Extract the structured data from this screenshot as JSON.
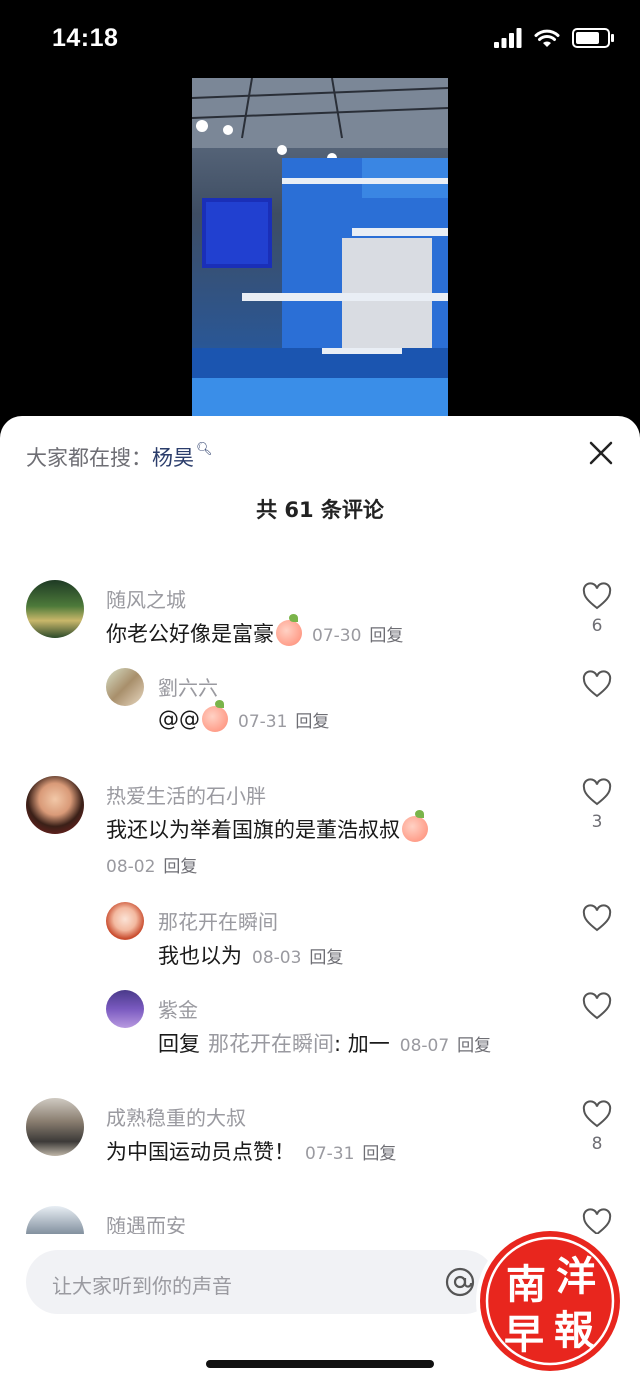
{
  "status_bar": {
    "time": "14:18",
    "battery_level": 0.75
  },
  "sheet": {
    "search_prefix": "大家都在搜：",
    "search_keyword": "杨昊",
    "comment_count": "共 61 条评论"
  },
  "comments": [
    {
      "username": "随风之城",
      "text": "你老公好像是富豪",
      "has_emoji": true,
      "date": "07-30",
      "reply": "回复",
      "likes": "6"
    },
    {
      "username": "劉六六",
      "text": "@@",
      "has_emoji": true,
      "date": "07-31",
      "reply": "回复"
    },
    {
      "username": "热爱生活的石小胖",
      "text": "我还以为举着国旗的是董浩叔叔",
      "has_emoji": true,
      "date": "08-02",
      "reply": "回复",
      "likes": "3"
    },
    {
      "username": "那花开在瞬间",
      "text": "我也以为",
      "date": "08-03",
      "reply": "回复"
    },
    {
      "username": "紫金",
      "text": "回复",
      "reply_to": "那花开在瞬间",
      "suffix": ": 加一",
      "date": "08-07",
      "reply": "回复"
    },
    {
      "username": "成熟稳重的大叔",
      "text": "为中国运动员点赞！",
      "date": "07-31",
      "reply": "回复",
      "likes": "8"
    },
    {
      "username": "随遇而安"
    }
  ],
  "input": {
    "placeholder": "让大家听到你的声音"
  },
  "watermark": {
    "chars": [
      "南",
      "洋",
      "早",
      "報"
    ]
  },
  "colors": {
    "accent_blue": "#2b3d6b",
    "watermark_red": "#e8261e"
  }
}
